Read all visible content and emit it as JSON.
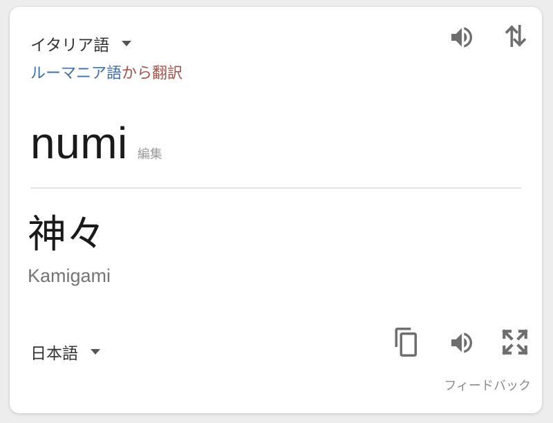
{
  "source": {
    "language_label": "イタリア語",
    "detected_language": "ルーマニア語",
    "detected_suffix": "から翻訳",
    "text": "numi",
    "edit_label": "編集"
  },
  "target": {
    "language_label": "日本語",
    "text": "神々",
    "romanization": "Kamigami"
  },
  "footer": {
    "feedback_label": "フィードバック"
  },
  "icons": {
    "speaker": "speaker-icon",
    "swap": "swap-languages-icon",
    "copy": "copy-icon",
    "fullscreen": "fullscreen-icon",
    "dropdown": "chevron-down-icon"
  },
  "colors": {
    "detected_language": "#3f6fa6",
    "detected_suffix": "#a4524a",
    "icon": "#6e6e6e"
  }
}
